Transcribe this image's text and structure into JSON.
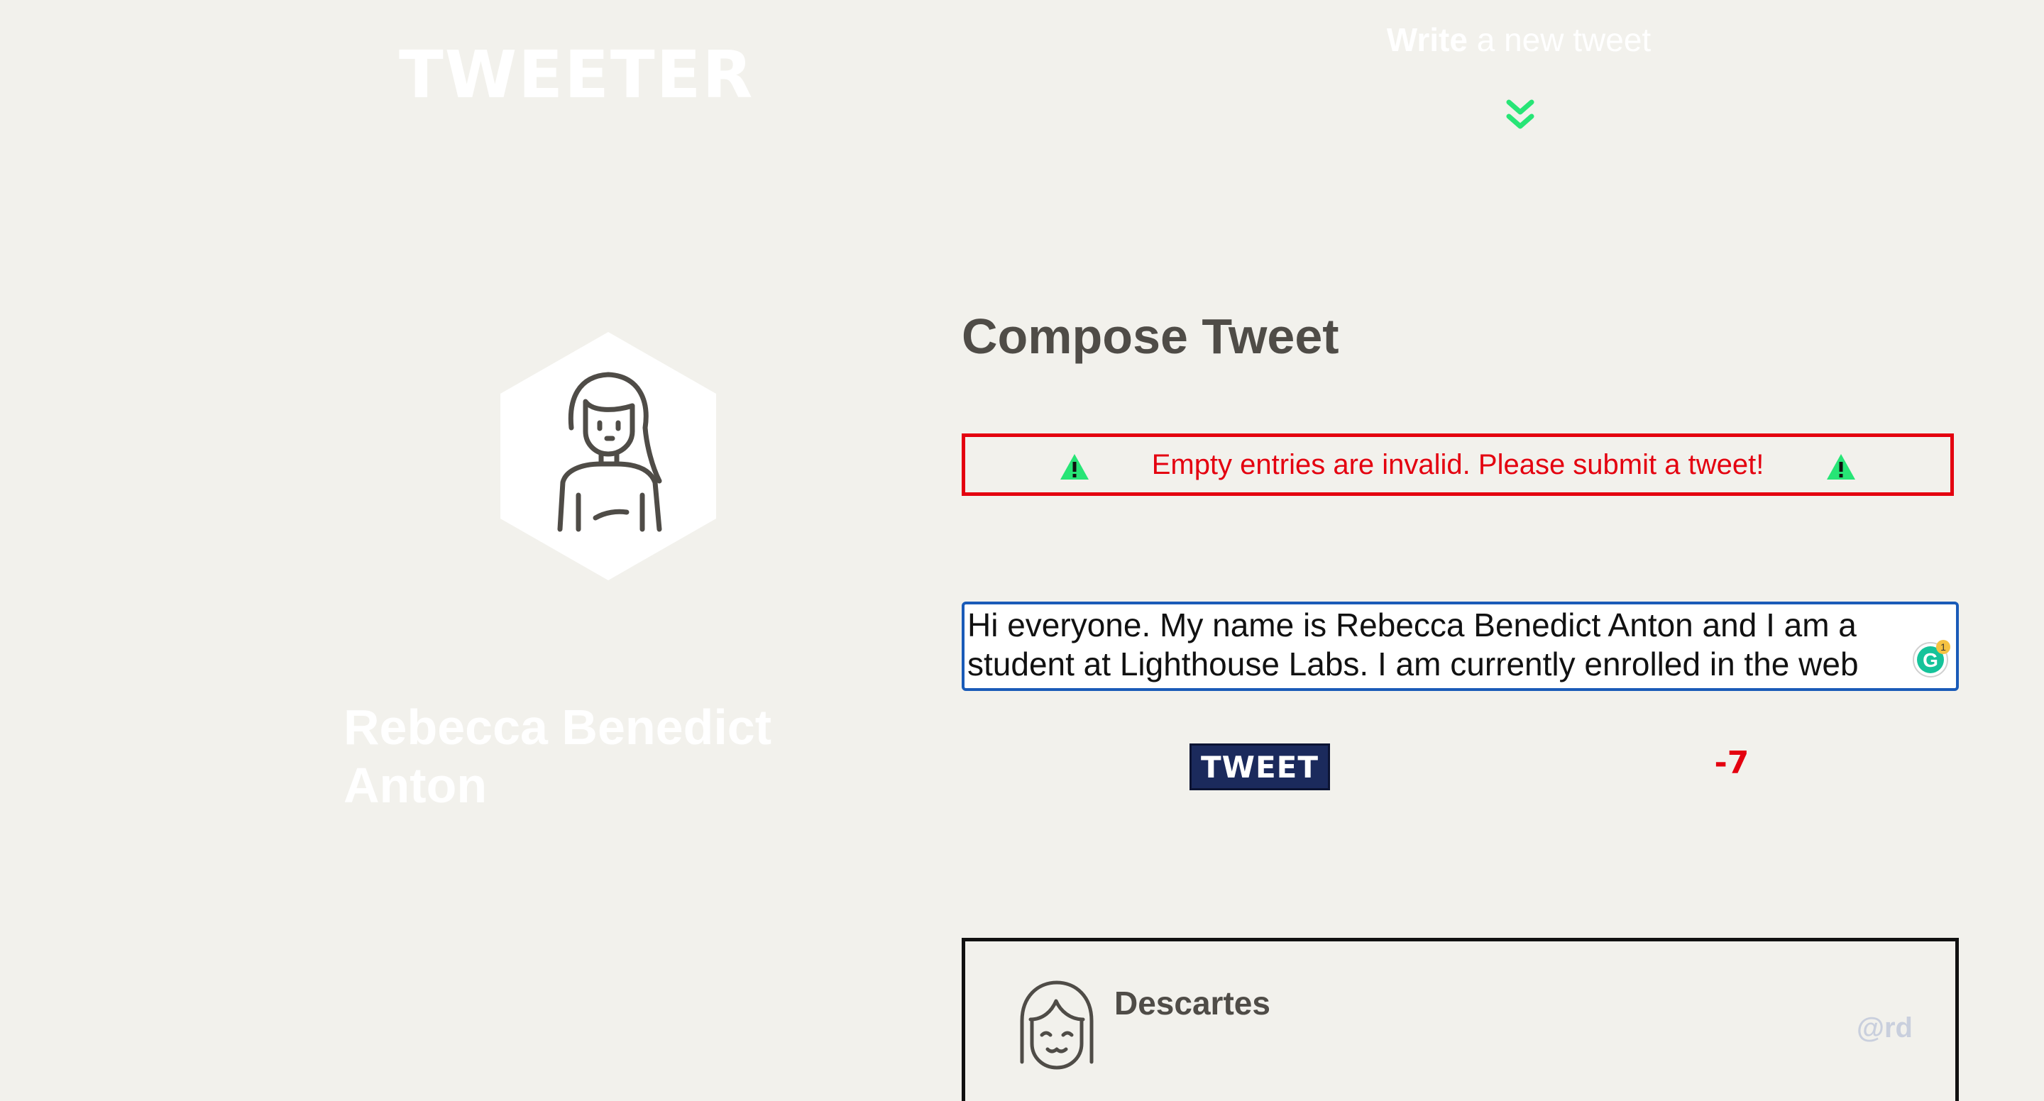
{
  "app": {
    "brand": "TWEETER"
  },
  "nav": {
    "write_bold": "Write",
    "write_rest": " a new tweet",
    "chevron_icon": "double-chevron-down-icon",
    "accent_color": "#27e576"
  },
  "profile": {
    "name": "Rebecca Benedict Anton",
    "avatar_icon": "woman-avatar-icon"
  },
  "compose": {
    "title": "Compose Tweet",
    "error_message": "Empty entries are invalid. Please submit a tweet!",
    "error_icon": "warning-triangle-icon",
    "error_color": "#e4000f",
    "textarea_value": "Hi everyone. My name is Rebecca Benedict Anton and I am a student at Lighthouse Labs. I am currently enrolled in the web",
    "submit_label": "TWEET",
    "char_counter": "-7",
    "grammarly_badge": "1"
  },
  "tweets": [
    {
      "author": "Descartes",
      "handle": "@rd",
      "avatar_icon": "girl-face-avatar-icon"
    }
  ]
}
